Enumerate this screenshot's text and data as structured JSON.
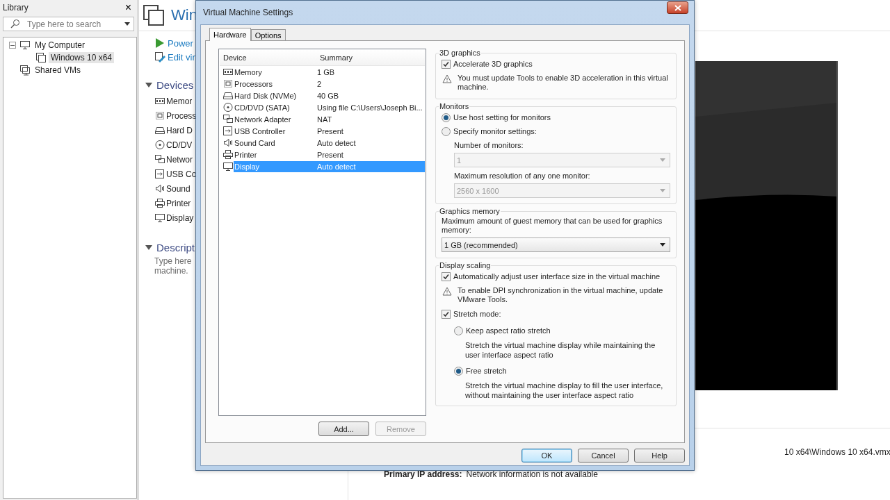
{
  "library": {
    "title": "Library",
    "close": "×",
    "search": {
      "placeholder": "Type here to search"
    },
    "tree": [
      {
        "label": "My Computer",
        "kind": "computer",
        "expanded": true,
        "selected": false,
        "children": [
          {
            "label": "Windows 10 x64",
            "kind": "vm",
            "selected": true
          }
        ]
      },
      {
        "label": "Shared VMs",
        "kind": "shared",
        "selected": false
      }
    ]
  },
  "vm_panel": {
    "title": "Win",
    "actions": [
      {
        "kind": "power",
        "label": "Power"
      },
      {
        "kind": "edit",
        "label": "Edit vir"
      }
    ],
    "devices_heading": "Devices",
    "devices": [
      {
        "kind": "memory",
        "label": "Memor"
      },
      {
        "kind": "processor",
        "label": "Process"
      },
      {
        "kind": "disk",
        "label": "Hard D"
      },
      {
        "kind": "cd",
        "label": "CD/DV"
      },
      {
        "kind": "network",
        "label": "Networ"
      },
      {
        "kind": "usb",
        "label": "USB Co"
      },
      {
        "kind": "sound",
        "label": "Sound"
      },
      {
        "kind": "printer",
        "label": "Printer"
      },
      {
        "kind": "display",
        "label": "Display"
      }
    ],
    "description_heading": "Descript",
    "description": [
      "Type here",
      "machine."
    ],
    "details": [
      {
        "value": "10 x64\\Windows 10 x64.vmx"
      },
      {
        "label": "Primary IP address:",
        "value": "Network information is not available"
      }
    ]
  },
  "dialog": {
    "title": "Virtual Machine Settings",
    "tabs": [
      {
        "label": "Hardware",
        "selected": true
      },
      {
        "label": "Options",
        "selected": false
      }
    ],
    "device_list": {
      "columns": [
        "Device",
        "Summary"
      ],
      "rows": [
        {
          "kind": "memory",
          "device": "Memory",
          "summary": "1 GB",
          "selected": false
        },
        {
          "kind": "processor",
          "device": "Processors",
          "summary": "2",
          "selected": false
        },
        {
          "kind": "disk",
          "device": "Hard Disk (NVMe)",
          "summary": "40 GB",
          "selected": false
        },
        {
          "kind": "cd",
          "device": "CD/DVD (SATA)",
          "summary": "Using file C:\\Users\\Joseph Bi...",
          "selected": false
        },
        {
          "kind": "network",
          "device": "Network Adapter",
          "summary": "NAT",
          "selected": false
        },
        {
          "kind": "usb",
          "device": "USB Controller",
          "summary": "Present",
          "selected": false
        },
        {
          "kind": "sound",
          "device": "Sound Card",
          "summary": "Auto detect",
          "selected": false
        },
        {
          "kind": "printer",
          "device": "Printer",
          "summary": "Present",
          "selected": false
        },
        {
          "kind": "display",
          "device": "Display",
          "summary": "Auto detect",
          "selected": true
        }
      ]
    },
    "list_buttons": [
      {
        "label": "Add...",
        "disabled": false
      },
      {
        "label": "Remove",
        "disabled": true
      }
    ],
    "groups": [
      {
        "title": "3D graphics",
        "items": [
          {
            "kind": "checkbox",
            "label": "Accelerate 3D graphics",
            "checked": true
          },
          {
            "kind": "warning",
            "text": "You must update Tools to enable 3D acceleration in this virtual machine."
          }
        ]
      },
      {
        "title": "Monitors",
        "items": [
          {
            "kind": "radio",
            "label": "Use host setting for monitors",
            "selected": true
          },
          {
            "kind": "radio",
            "label": "Specify monitor settings:",
            "selected": false
          },
          {
            "kind": "select",
            "label": "Number of monitors:",
            "value": "1",
            "disabled": true
          },
          {
            "kind": "select",
            "label": "Maximum resolution of any one monitor:",
            "value": "2560 x 1600",
            "disabled": true
          }
        ]
      },
      {
        "title": "Graphics memory",
        "items": [
          {
            "kind": "text",
            "text": "Maximum amount of guest memory that can be used for graphics memory:"
          },
          {
            "kind": "select",
            "value": "1 GB (recommended)",
            "disabled": false
          }
        ]
      },
      {
        "title": "Display scaling",
        "items": [
          {
            "kind": "checkbox",
            "label": "Automatically adjust user interface size in the virtual machine",
            "checked": true
          },
          {
            "kind": "warning",
            "text": "To enable DPI synchronization in the virtual machine, update VMware Tools."
          },
          {
            "kind": "checkbox",
            "label": "Stretch mode:",
            "checked": true
          },
          {
            "kind": "radio",
            "label": "Keep aspect ratio stretch",
            "selected": false,
            "description": "Stretch the virtual machine display while maintaining the user interface aspect ratio"
          },
          {
            "kind": "radio",
            "label": "Free stretch",
            "selected": true,
            "description": "Stretch the virtual machine display to fill the user interface, without maintaining the user interface aspect ratio"
          }
        ]
      }
    ],
    "buttons": [
      {
        "label": "OK",
        "default": true
      },
      {
        "label": "Cancel",
        "default": false
      },
      {
        "label": "Help",
        "default": false
      }
    ]
  }
}
